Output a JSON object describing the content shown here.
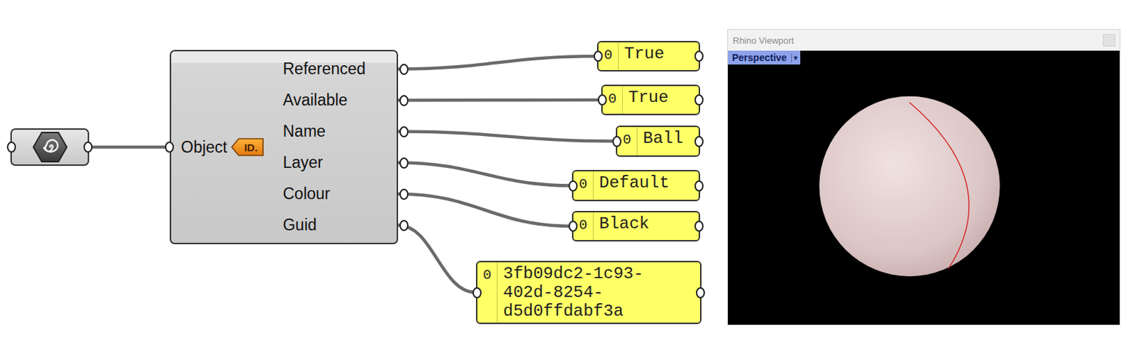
{
  "parameter": {
    "kind": "object-id"
  },
  "component": {
    "input": "Object",
    "input_tag": "ID.",
    "outputs": [
      {
        "label": "Referenced",
        "panel": {
          "index": "0",
          "value": "True"
        }
      },
      {
        "label": "Available",
        "panel": {
          "index": "0",
          "value": "True"
        }
      },
      {
        "label": "Name",
        "panel": {
          "index": "0",
          "value": "Ball"
        }
      },
      {
        "label": "Layer",
        "panel": {
          "index": "0",
          "value": "Default"
        }
      },
      {
        "label": "Colour",
        "panel": {
          "index": "0",
          "value": "Black"
        }
      },
      {
        "label": "Guid",
        "panel": {
          "index": "0",
          "value": "3fb09dc2-1c93-402d-8254-d5d0ffdabf3a"
        }
      }
    ]
  },
  "viewport": {
    "title": "Rhino Viewport",
    "view": "Perspective",
    "dropdown": "▾"
  }
}
